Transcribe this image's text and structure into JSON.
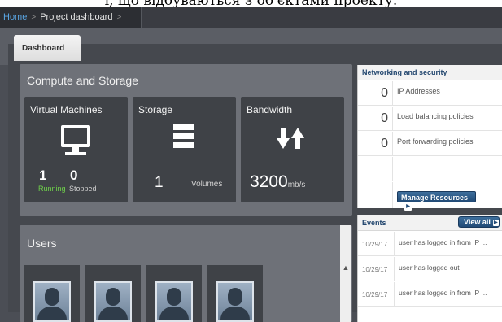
{
  "caption": "l, що відбуваються з об'єктами проекту.",
  "breadcrumb": {
    "home": "Home",
    "separator": ">",
    "current": "Project dashboard",
    "trailing": ">"
  },
  "tabs": [
    {
      "label": "Dashboard"
    }
  ],
  "compute": {
    "title": "Compute and Storage",
    "virtual_machines": {
      "title": "Virtual Machines",
      "icon": "monitor-icon",
      "running_count": "1",
      "running_label": "Running",
      "stopped_count": "0",
      "stopped_label": "Stopped",
      "running_color": "#6fd24a"
    },
    "storage": {
      "title": "Storage",
      "icon": "storage-icon",
      "count": "1",
      "unit": "Volumes"
    },
    "bandwidth": {
      "title": "Bandwidth",
      "icon": "bandwidth-icon",
      "value": "3200",
      "unit": "mb/s"
    }
  },
  "users": {
    "title": "Users",
    "avatars": 4,
    "avatar_icon": "user-avatar-icon"
  },
  "networking": {
    "title": "Networking and security",
    "rows": [
      {
        "count": "0",
        "label": "IP Addresses"
      },
      {
        "count": "0",
        "label": "Load balancing policies"
      },
      {
        "count": "0",
        "label": "Port forwarding policies"
      }
    ],
    "manage_button": "Manage Resources"
  },
  "events": {
    "title": "Events",
    "view_all": "View all",
    "items": [
      {
        "date": "10/29/17",
        "text": "user has logged in from IP ..."
      },
      {
        "date": "10/29/17",
        "text": "user has logged out"
      },
      {
        "date": "10/29/17",
        "text": "user has logged in from IP ..."
      }
    ]
  },
  "colors": {
    "accent": "#214a76",
    "link": "#5aa7e6",
    "panel": "#6e7178",
    "tile": "#3f4247"
  }
}
